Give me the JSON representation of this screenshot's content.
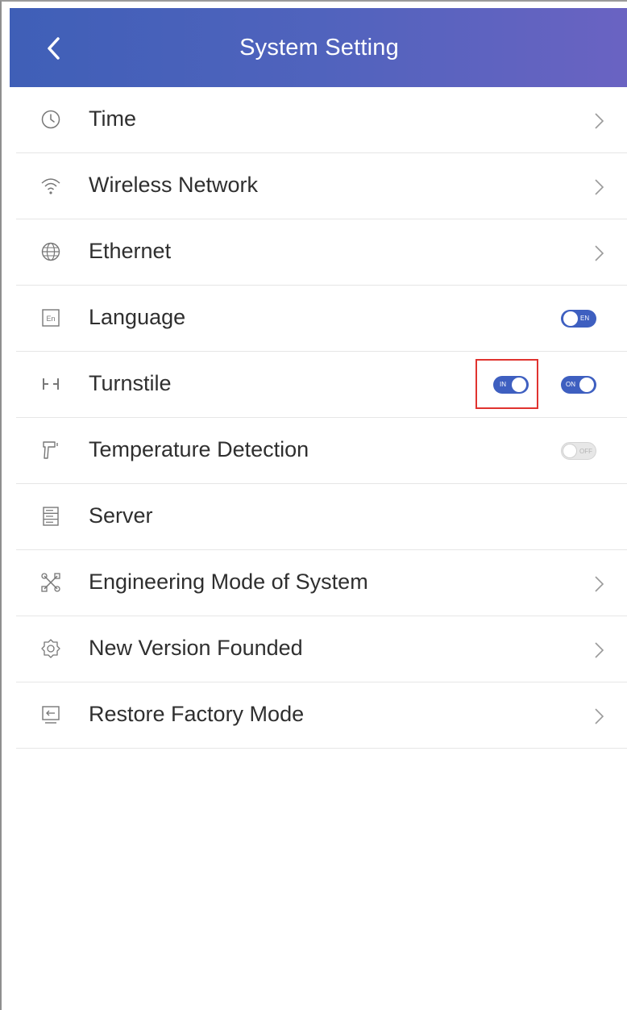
{
  "header": {
    "title": "System Setting",
    "back_icon": "chevron-left-icon"
  },
  "colors": {
    "header_start": "#3f5fb7",
    "header_end": "#6a63c2",
    "toggle_on": "#3e5fc0",
    "highlight": "#e0332f"
  },
  "settings": {
    "time": {
      "label": "Time",
      "icon": "clock-icon"
    },
    "wireless": {
      "label": "Wireless Network",
      "icon": "wifi-icon"
    },
    "ethernet": {
      "label": "Ethernet",
      "icon": "globe-icon"
    },
    "language": {
      "label": "Language",
      "icon": "language-en-icon",
      "toggle": {
        "state": "on",
        "text": "EN"
      }
    },
    "turnstile": {
      "label": "Turnstile",
      "icon": "turnstile-icon",
      "toggle_direction": {
        "state": "on",
        "text": "IN"
      },
      "toggle_enable": {
        "state": "on",
        "text": "ON"
      }
    },
    "temperature": {
      "label": "Temperature Detection",
      "icon": "thermometer-gun-icon",
      "toggle": {
        "state": "off",
        "text": "OFF"
      }
    },
    "server": {
      "label": "Server",
      "icon": "server-icon"
    },
    "engineering": {
      "label": "Engineering Mode of System",
      "icon": "tools-icon"
    },
    "version": {
      "label": "New Version Founded",
      "icon": "gear-icon"
    },
    "restore": {
      "label": "Restore Factory Mode",
      "icon": "restore-icon"
    }
  }
}
